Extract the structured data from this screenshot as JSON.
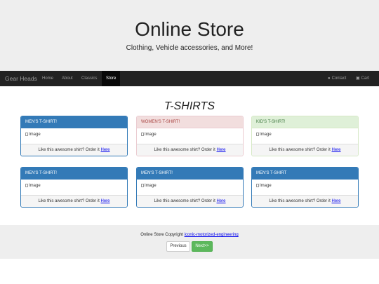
{
  "header": {
    "title": "Online Store",
    "subtitle": "Clothing, Vehicle accessories, and More!"
  },
  "navbar": {
    "brand": "Gear Heads",
    "items": [
      {
        "label": "Home",
        "active": false
      },
      {
        "label": "About",
        "active": false
      },
      {
        "label": "Classics",
        "active": false
      },
      {
        "label": "Store",
        "active": true
      }
    ],
    "right": [
      {
        "label": "Contact",
        "icon": "user-icon"
      },
      {
        "label": "Cart",
        "icon": "cart-icon"
      }
    ]
  },
  "main": {
    "title": "T-SHIRTS",
    "panels": [
      {
        "title": "MEN'S T-SHIRT!",
        "style": "primary",
        "image_alt": "Image",
        "footer_text": "Like this awesome shirt? Order it",
        "link": "Here"
      },
      {
        "title": "WOMEN'S T-SHIRT!",
        "style": "danger",
        "image_alt": "Image",
        "footer_text": "Like this awesome shirt? Order it",
        "link": "Here"
      },
      {
        "title": "KID'S T-SHIRT!",
        "style": "success",
        "image_alt": "Image",
        "footer_text": "Like this awesome shirt? Order it",
        "link": "Here"
      },
      {
        "title": "MEN'S T-SHIRT!",
        "style": "primary",
        "image_alt": "Image",
        "footer_text": "Like this awesome shirt? Order it",
        "link": "Here"
      },
      {
        "title": "MEN'S T-SHIRT!",
        "style": "primary",
        "image_alt": "Image",
        "footer_text": "Like this awesome shirt? Order it",
        "link": "Here"
      },
      {
        "title": "MEN'S T-SHIRT",
        "style": "primary",
        "image_alt": "Image",
        "footer_text": "Like this awesome shirt? Order it",
        "link": "Here"
      }
    ]
  },
  "footer": {
    "copyright_text": "Online Store Copyright",
    "copyright_link": "iconic-motorized-engineering",
    "prev_label": "Previous",
    "next_label": "Next>>"
  },
  "colors": {
    "primary": "#337ab7",
    "danger_bg": "#f2dede",
    "success_bg": "#dff0d8",
    "navbar": "#222222",
    "next_button": "#5cb85c"
  }
}
